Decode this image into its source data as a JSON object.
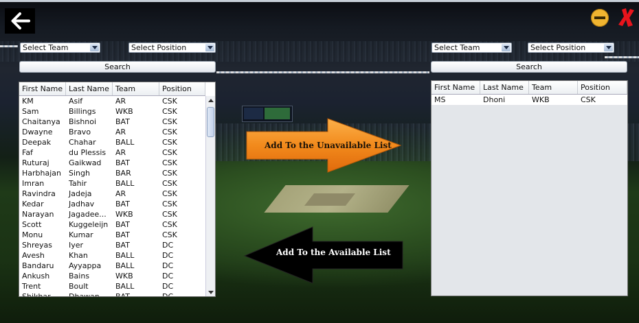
{
  "left_panel": {
    "team_select": "Select Team",
    "position_select": "Select Position",
    "search_label": "Search",
    "columns": [
      "First Name",
      "Last Name",
      "Team",
      "Position"
    ],
    "rows": [
      [
        "KM",
        "Asif",
        "AR",
        "CSK"
      ],
      [
        "Sam",
        "Billings",
        "WKB",
        "CSK"
      ],
      [
        "Chaitanya",
        "Bishnoi",
        "BAT",
        "CSK"
      ],
      [
        "Dwayne",
        "Bravo",
        "AR",
        "CSK"
      ],
      [
        "Deepak",
        "Chahar",
        "BALL",
        "CSK"
      ],
      [
        "Faf",
        "du Plessis",
        "AR",
        "CSK"
      ],
      [
        "Ruturaj",
        "Gaikwad",
        "BAT",
        "CSK"
      ],
      [
        "Harbhajan",
        "Singh",
        "BAR",
        "CSK"
      ],
      [
        "Imran",
        "Tahir",
        "BALL",
        "CSK"
      ],
      [
        "Ravindra",
        "Jadeja",
        "AR",
        "CSK"
      ],
      [
        "Kedar",
        "Jadhav",
        "BAT",
        "CSK"
      ],
      [
        "Narayan",
        "Jagadee...",
        "WKB",
        "CSK"
      ],
      [
        "Scott",
        "Kuggeleijn",
        "BAT",
        "CSK"
      ],
      [
        "Monu",
        "Kumar",
        "BAT",
        "CSK"
      ],
      [
        "Shreyas",
        "Iyer",
        "BAT",
        "DC"
      ],
      [
        "Avesh",
        "Khan",
        "BALL",
        "DC"
      ],
      [
        "Bandaru",
        "Ayyappa",
        "BALL",
        "DC"
      ],
      [
        "Ankush",
        "Bains",
        "WKB",
        "DC"
      ],
      [
        "Trent",
        "Boult",
        "BALL",
        "DC"
      ],
      [
        "Shikhar",
        "Dhawan",
        "BAT",
        "DC"
      ]
    ]
  },
  "right_panel": {
    "team_select": "Select Team",
    "position_select": "Select Position",
    "search_label": "Search",
    "columns": [
      "First Name",
      "Last Name",
      "Team",
      "Position"
    ],
    "rows": [
      [
        "MS",
        "Dhoni",
        "WKB",
        "CSK"
      ]
    ]
  },
  "actions": {
    "add_unavailable": "Add To the Unavailable List",
    "add_available": "Add To the Available List"
  },
  "colors": {
    "unavailable_arrow": "#f28a1c",
    "available_arrow": "#000000",
    "close_icon": "#e8141c",
    "minimize_icon": "#f0b430"
  },
  "icons": {
    "back": "left-arrow-icon",
    "minimize": "minimize-icon",
    "close": "close-icon"
  }
}
